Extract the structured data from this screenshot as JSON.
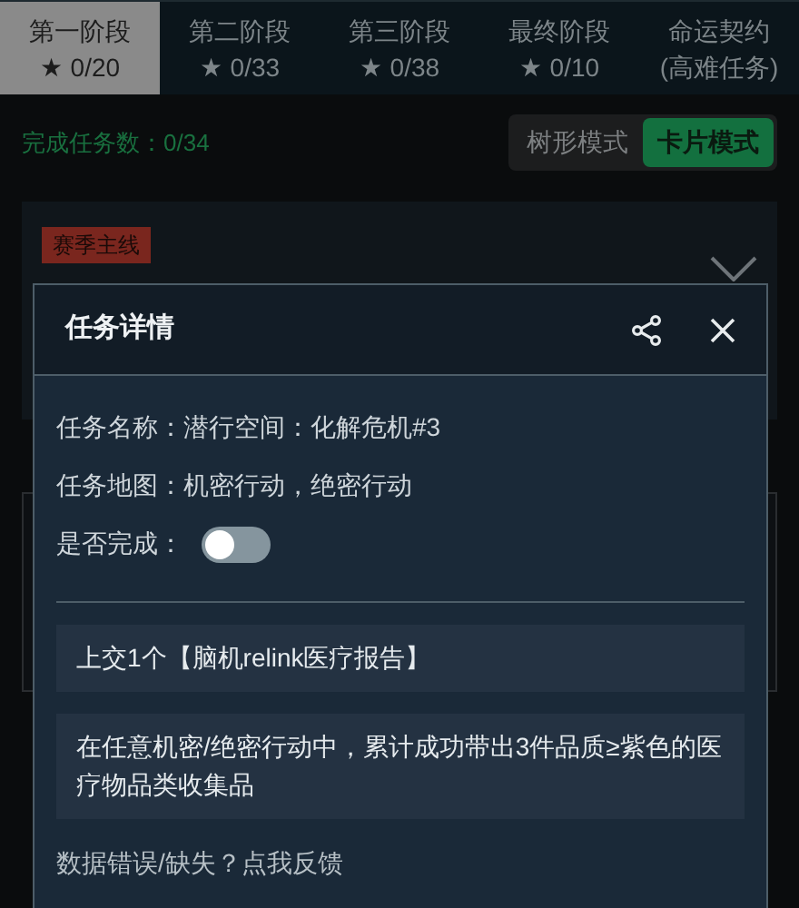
{
  "tabs": [
    {
      "title": "第一阶段",
      "subtitle": "★ 0/20",
      "selected": true
    },
    {
      "title": "第二阶段",
      "subtitle": "★ 0/33",
      "selected": false
    },
    {
      "title": "第三阶段",
      "subtitle": "★ 0/38",
      "selected": false
    },
    {
      "title": "最终阶段",
      "subtitle": "★ 0/10",
      "selected": false
    },
    {
      "title": "命运契约",
      "subtitle": "(高难任务)",
      "selected": false
    }
  ],
  "progress": "完成任务数：0/34",
  "view_modes": [
    {
      "label": "树形模式",
      "selected": false
    },
    {
      "label": "卡片模式",
      "selected": true
    }
  ],
  "card": {
    "tag": "赛季主线"
  },
  "dialog": {
    "title": "任务详情",
    "fields": [
      {
        "label": "任务名称：",
        "value": "潜行空间：化解危机#3"
      },
      {
        "label": "任务地图：",
        "value": "机密行动，绝密行动"
      }
    ],
    "completed": {
      "label": "是否完成：",
      "on": false
    },
    "requirements": [
      "上交1个【脑机relink医疗报告】",
      "在任意机密/绝密行动中，累计成功带出3件品质≥紫色的医疗物品类收集品"
    ],
    "feedback_link": "数据错误/缺失？点我反馈"
  }
}
